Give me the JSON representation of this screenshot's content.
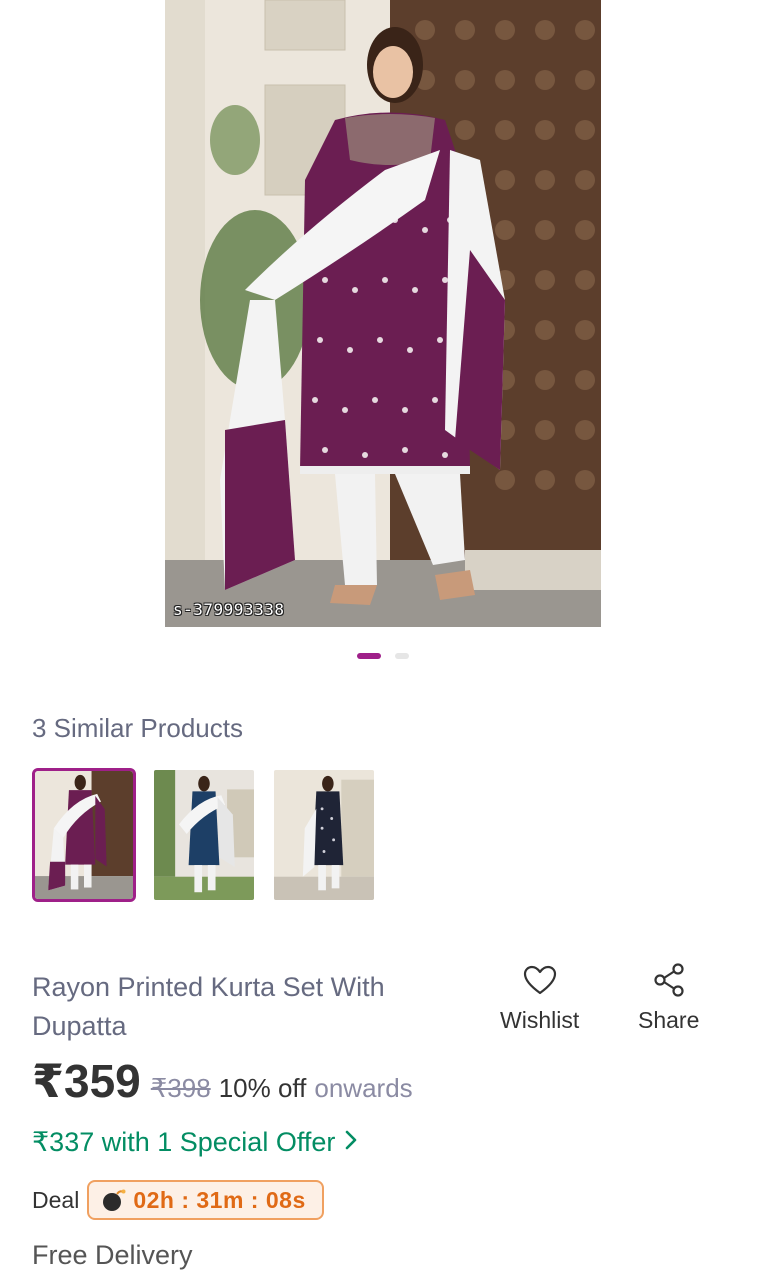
{
  "product_image": {
    "watermark_id": "s-379993338",
    "carousel_count": 2,
    "carousel_active": 0
  },
  "similar": {
    "title": "3 Similar Products",
    "items": [
      {
        "color": "#6b1e52",
        "selected": true
      },
      {
        "color": "#1d3f66",
        "selected": false
      },
      {
        "color": "#1f2436",
        "selected": false
      }
    ]
  },
  "product": {
    "title": "Rayon Printed Kurta Set With Dupatta",
    "price": "₹359",
    "mrp": "₹398",
    "discount": "10% off",
    "onwards": "onwards",
    "special_offer": "₹337 with 1 Special Offer",
    "deal_label": "Deal",
    "deal_timer": "02h : 31m : 08s",
    "delivery": "Free Delivery"
  },
  "actions": {
    "wishlist_label": "Wishlist",
    "share_label": "Share",
    "wishlist_icon": "heart-icon",
    "share_icon": "share-icon"
  },
  "colors": {
    "brand": "#9f2089",
    "offer_green": "#038d63",
    "deal_orange": "#e06a16"
  }
}
